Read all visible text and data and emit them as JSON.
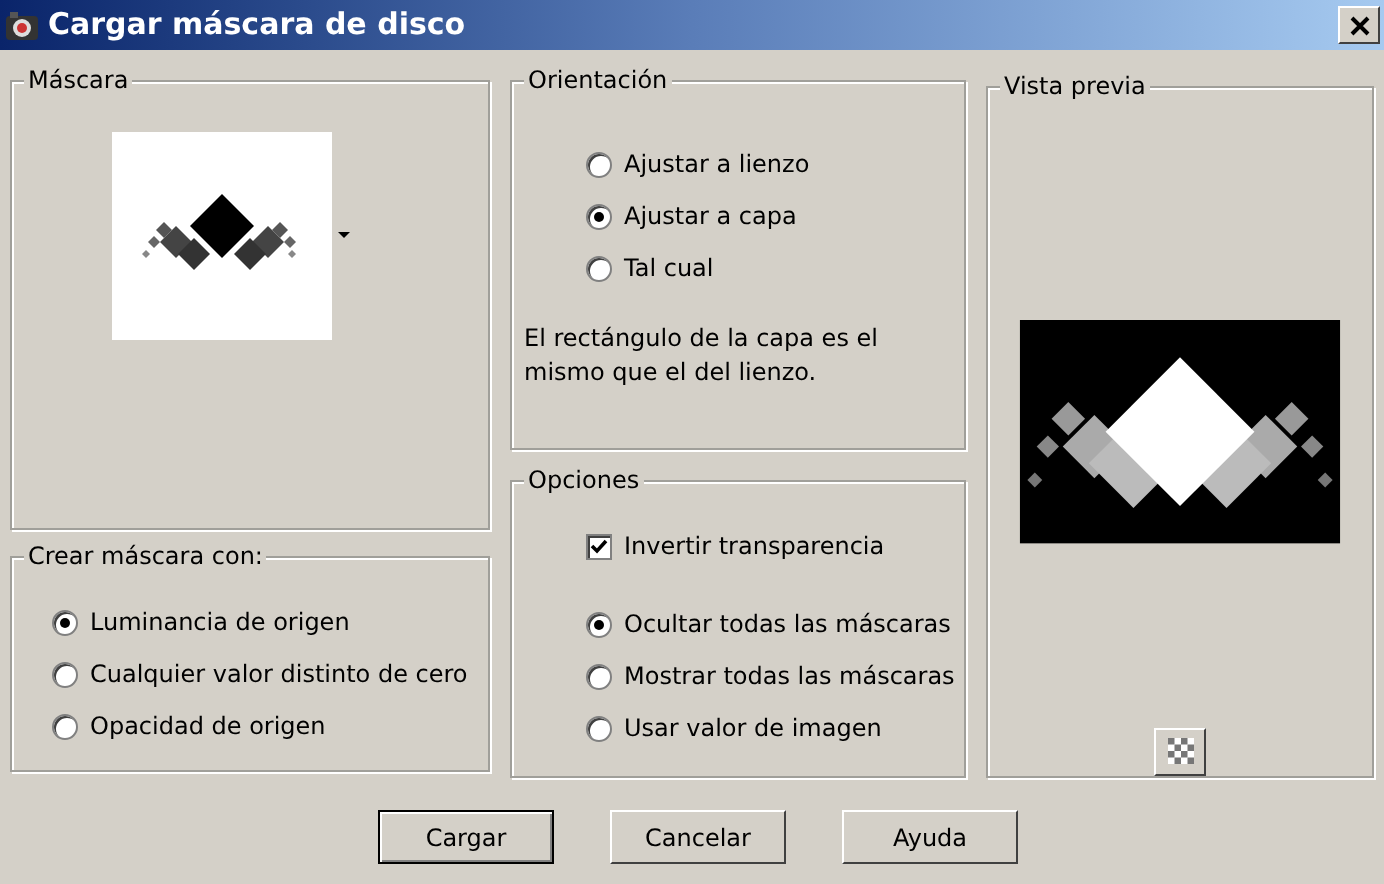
{
  "window": {
    "title": "Cargar máscara de disco"
  },
  "mask": {
    "label": "Máscara"
  },
  "create_mask": {
    "label": "Crear máscara con:",
    "options": [
      {
        "label": "Luminancia de origen",
        "selected": true
      },
      {
        "label": "Cualquier valor distinto de cero",
        "selected": false
      },
      {
        "label": "Opacidad de origen",
        "selected": false
      }
    ]
  },
  "orientation": {
    "label": "Orientación",
    "options": [
      {
        "label": "Ajustar a lienzo",
        "selected": false
      },
      {
        "label": "Ajustar a capa",
        "selected": true
      },
      {
        "label": "Tal cual",
        "selected": false
      }
    ],
    "note": "El rectángulo de la capa es el mismo que el del lienzo."
  },
  "options": {
    "label": "Opciones",
    "items": [
      {
        "kind": "checkbox",
        "label": "Invertir transparencia",
        "checked": true
      },
      {
        "kind": "radio",
        "label": "Ocultar todas las máscaras",
        "selected": true
      },
      {
        "kind": "radio",
        "label": "Mostrar todas las máscaras",
        "selected": false
      },
      {
        "kind": "radio",
        "label": "Usar valor de imagen",
        "selected": false
      }
    ]
  },
  "preview": {
    "label": "Vista previa"
  },
  "buttons": [
    {
      "label": "Cargar",
      "default": true
    },
    {
      "label": "Cancelar",
      "default": false
    },
    {
      "label": "Ayuda",
      "default": false
    }
  ]
}
